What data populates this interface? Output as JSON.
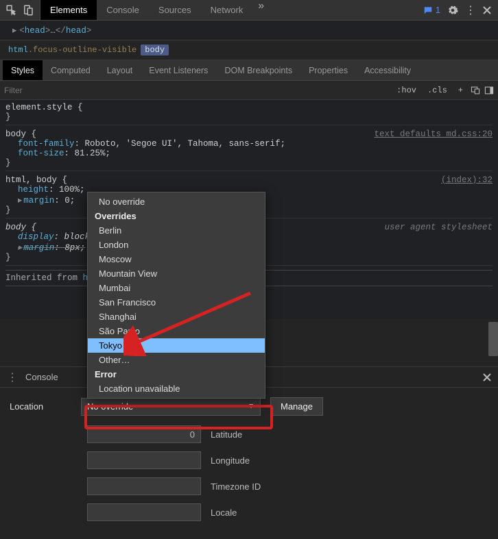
{
  "toolbar": {
    "tabs": [
      "Elements",
      "Console",
      "Sources",
      "Network"
    ],
    "active": "Elements",
    "message_count": "1"
  },
  "dom": {
    "head_open": "<head>",
    "head_ell": "…",
    "head_close": "</head>"
  },
  "crumb": {
    "html": "html",
    "html_class": ".focus-outline-visible",
    "body": "body"
  },
  "panel_tabs": [
    "Styles",
    "Computed",
    "Layout",
    "Event Listeners",
    "DOM Breakpoints",
    "Properties",
    "Accessibility"
  ],
  "panel_active": "Styles",
  "filter_placeholder": "Filter",
  "filter_right": {
    "hov": ":hov",
    "cls": ".cls",
    "plus": "+"
  },
  "styles_rules": {
    "element_style": "element.style {",
    "close": "}",
    "body_sel": "body {",
    "body_src": "text_defaults_md.css:20",
    "body_ff_prop": "font-family",
    "body_ff_val": ": Roboto, 'Segoe UI', Tahoma, sans-serif;",
    "body_fs_prop": "font-size",
    "body_fs_val": ": 81.25%;",
    "htmlbody_sel": "html, body {",
    "htmlbody_src": "(index):32",
    "hb_h_prop": "height",
    "hb_h_val": ": 100%;",
    "hb_m_prop": "margin",
    "hb_m_val": ": 0;",
    "body2_sel": "body {",
    "body2_src": "user agent stylesheet",
    "body2_d_prop": "display",
    "body2_d_val": ": block;",
    "body2_m_prop": "margin",
    "body2_m_val": ": 8px;",
    "inh": "Inherited from ",
    "inh_el": "html.focus-outli…"
  },
  "dropdown": {
    "no_override": "No override",
    "overrides_h": "Overrides",
    "cities": [
      "Berlin",
      "London",
      "Moscow",
      "Mountain View",
      "Mumbai",
      "San Francisco",
      "Shanghai",
      "São Paulo",
      "Tokyo"
    ],
    "selected": "Tokyo",
    "other": "Other…",
    "error_h": "Error",
    "error_item": "Location unavailable"
  },
  "drawer": {
    "title": "Console"
  },
  "sensors": {
    "location_label": "Location",
    "current": "No override",
    "manage": "Manage",
    "fields": {
      "lat": {
        "value": "0",
        "label": "Latitude"
      },
      "lon": {
        "value": "",
        "label": "Longitude"
      },
      "tz": {
        "value": "",
        "label": "Timezone ID"
      },
      "loc": {
        "value": "",
        "label": "Locale"
      }
    }
  }
}
